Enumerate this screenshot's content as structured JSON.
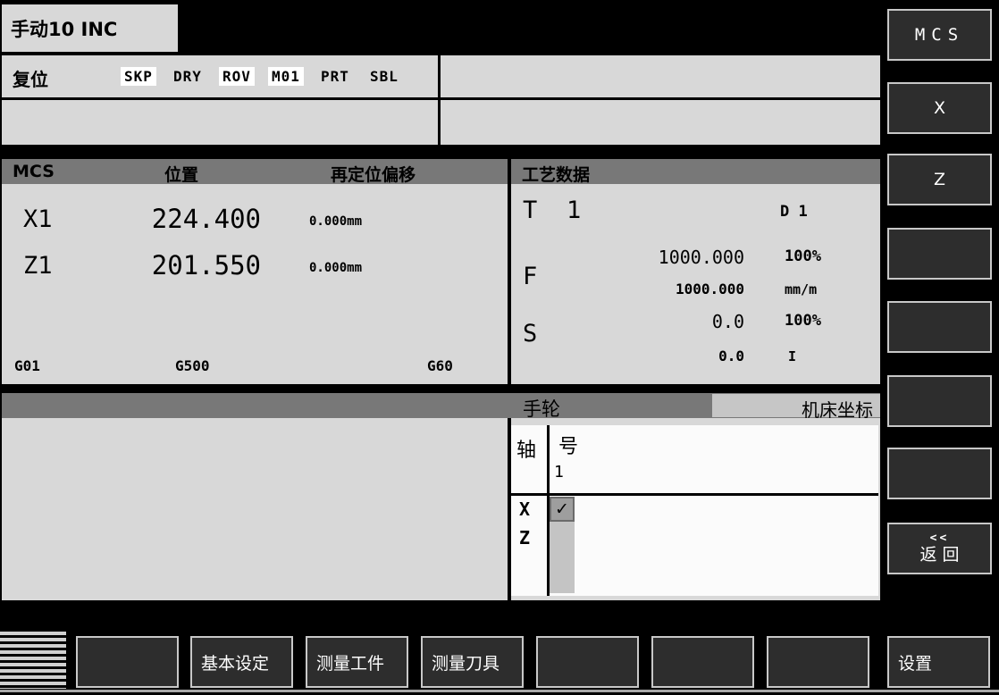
{
  "tab": {
    "title": "手动10 INC"
  },
  "status_bar": {
    "mode": "复位",
    "flags": [
      {
        "label": "SKP",
        "active": true
      },
      {
        "label": "DRY",
        "active": false
      },
      {
        "label": "ROV",
        "active": true
      },
      {
        "label": "M01",
        "active": true
      },
      {
        "label": "PRT",
        "active": false
      },
      {
        "label": "SBL",
        "active": false
      }
    ]
  },
  "position_panel": {
    "header": {
      "cs_label": "MCS",
      "position_label": "位置",
      "reposition_label": "再定位偏移"
    },
    "axes": [
      {
        "name": "X1",
        "position": "224.400",
        "offset": "0.000mm"
      },
      {
        "name": "Z1",
        "position": "201.550",
        "offset": "0.000mm"
      }
    ],
    "g_codes": [
      "G01",
      "G500",
      "G60"
    ]
  },
  "process_panel": {
    "title": "工艺数据",
    "tool": {
      "label": "T",
      "number": "1",
      "edge": "D 1"
    },
    "feed": {
      "label": "F",
      "actual": "1000.000",
      "override": "100%",
      "setpoint": "1000.000",
      "unit": "mm/m"
    },
    "spindle": {
      "label": "S",
      "actual": "0.0",
      "override": "100%",
      "setpoint": "0.0",
      "unit": "I"
    }
  },
  "handwheel": {
    "title": "手轮",
    "coord_button": "机床坐标",
    "axis_header": "轴",
    "number_header": "号",
    "number_value": "1",
    "rows": [
      {
        "axis": "X",
        "check": "✓"
      },
      {
        "axis": "Z",
        "check": ""
      }
    ]
  },
  "right_softkeys": [
    {
      "label": "MCS"
    },
    {
      "label": "X"
    },
    {
      "label": "Z"
    },
    {
      "label": ""
    },
    {
      "label": ""
    },
    {
      "label": ""
    },
    {
      "label": ""
    },
    {
      "label": "返 回",
      "prefix": "<<"
    }
  ],
  "bottom_softkeys": [
    {
      "label": ""
    },
    {
      "label": "基本设定"
    },
    {
      "label": "测量工件"
    },
    {
      "label": "测量刀具"
    },
    {
      "label": ""
    },
    {
      "label": ""
    },
    {
      "label": ""
    },
    {
      "label": "设置"
    }
  ],
  "colors": {
    "screen_bg": "#000000",
    "panel": "#d8d8d8",
    "header_band": "#787878",
    "flag_highlight": "#ffffff",
    "table_bg": "#fbfbfb",
    "coord_button_bg": "#c6c6c6",
    "checkbox_bg": "#9e9e9e",
    "strip": "#c4c4c4",
    "softkey_bg": "#2d2d2d",
    "softkey_border": "#c8c8c8"
  }
}
